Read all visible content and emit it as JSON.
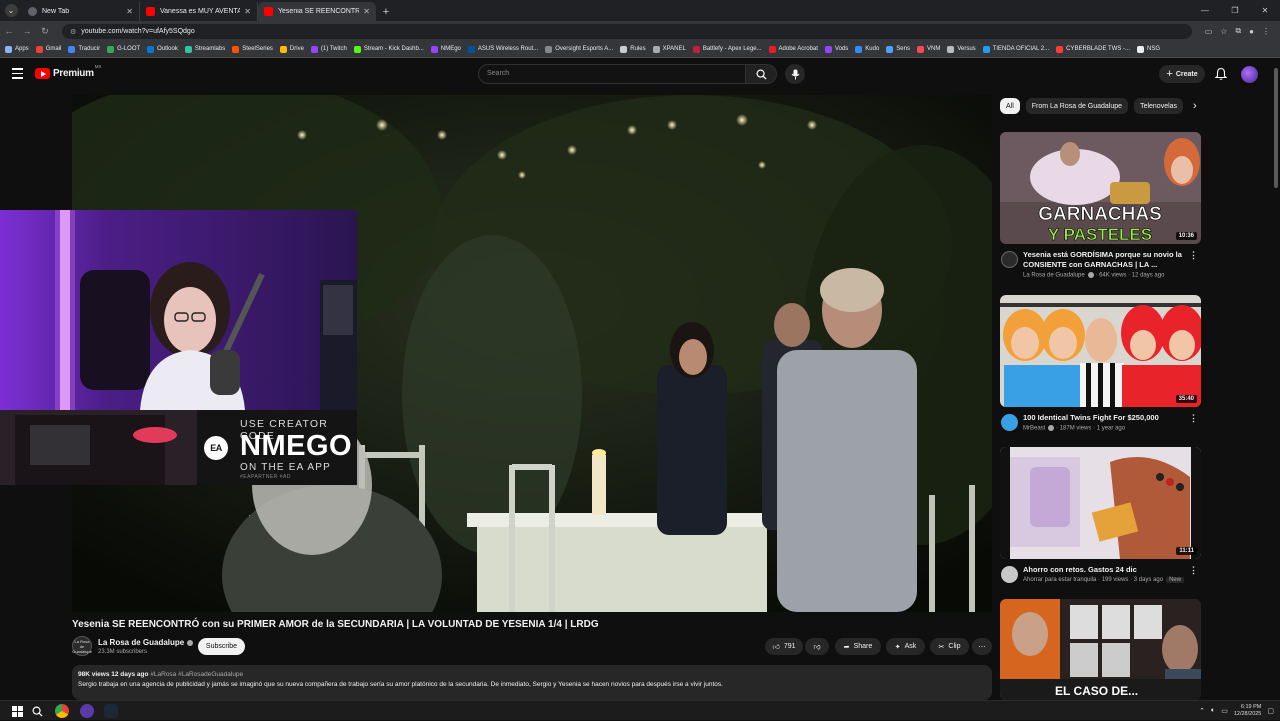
{
  "browser": {
    "tabs": [
      {
        "title": "New Tab",
        "fav_color": "#5f6368",
        "active": false
      },
      {
        "title": "Vanessa es MUY AVENTADA y j",
        "fav_color": "#ff0000",
        "active": false
      },
      {
        "title": "Yesenia SE REENCONTRÓ con s",
        "fav_color": "#ff0000",
        "active": true
      }
    ],
    "new_tab_symbol": "+",
    "url": "youtube.com/watch?v=ufAfy5SQdgo",
    "bookmarks": [
      {
        "label": "Apps",
        "color": "#8ab4f8"
      },
      {
        "label": "Gmail",
        "color": "#ea4335"
      },
      {
        "label": "Traducir",
        "color": "#4285f4"
      },
      {
        "label": "G-LOOT",
        "color": "#34a853"
      },
      {
        "label": "Outlook",
        "color": "#0078d4"
      },
      {
        "label": "Streamlabs",
        "color": "#31c3a2"
      },
      {
        "label": "SteelSeries",
        "color": "#ff5200"
      },
      {
        "label": "Drive",
        "color": "#fbbc04"
      },
      {
        "label": "(1) Twitch",
        "color": "#9146ff"
      },
      {
        "label": "Stream - Kick Dashb...",
        "color": "#53fc18"
      },
      {
        "label": "NMEgo",
        "color": "#9146ff"
      },
      {
        "label": "ASUS Wireless Rout...",
        "color": "#00539b"
      },
      {
        "label": "Oversight Esports A...",
        "color": "#888888"
      },
      {
        "label": "Rules",
        "color": "#cccccc"
      },
      {
        "label": "XPANEL",
        "color": "#aaaaaa"
      },
      {
        "label": "Battlefy - Apex Lege...",
        "color": "#c21f3a"
      },
      {
        "label": "Adobe Acrobat",
        "color": "#ec1c24"
      },
      {
        "label": "Vods",
        "color": "#9146ff"
      },
      {
        "label": "Kudo",
        "color": "#2d8cff"
      },
      {
        "label": "Sens",
        "color": "#4aa3ff"
      },
      {
        "label": "VNM",
        "color": "#ff4655"
      },
      {
        "label": "Versus",
        "color": "#bbbbbb"
      },
      {
        "label": "TIENDA OFICIAL 2...",
        "color": "#1da1f2"
      },
      {
        "label": "CYBERBLADE TWS -...",
        "color": "#ff3b30"
      },
      {
        "label": "NSG",
        "color": "#eeeeee"
      }
    ]
  },
  "youtube": {
    "logo_text": "Premium",
    "region": "MX",
    "search_placeholder": "Search",
    "create_label": "Create",
    "video": {
      "title": "Yesenia SE REENCONTRÓ con su PRIMER AMOR de la SECUNDARIA | LA VOLUNTAD DE YESENIA 1/4 | LRDG",
      "channel": "La Rosa de Guadalupe",
      "channel_avatar_text": "La Rosa de Guadalupe",
      "subscribers": "23.3M subscribers",
      "subscribe_label": "Subscribe",
      "likes": "791",
      "share_label": "Share",
      "ask_label": "Ask",
      "clip_label": "Clip",
      "views_date": "98K views  12 days ago",
      "tags": "#LaRosa #LaRosadeGuadalupe",
      "description": "Sergio trabaja en una agencia de publicidad y jamás se imaginó que su nueva compañera de trabajo sería su amor platónico de la secundaria. De inmediato, Sergio y Yesenia se hacen novios para después irse a vivir juntos."
    },
    "overlay": {
      "line1": "USE CREATOR CODE",
      "line2": "NMEGO",
      "line3": "ON THE EA APP",
      "line4": "#EAPARTNER #AD",
      "ea_logo": "EA"
    },
    "chips": [
      "All",
      "From La Rosa de Guadalupe",
      "Telenovelas"
    ],
    "recommendations": [
      {
        "title": "Yesenia está GORDÍSIMA porque su novio la CONSIENTE con GARNACHAS | LA ...",
        "channel": "La Rosa de Guadalupe",
        "meta": "64K views · 12 days ago",
        "duration": "10:36",
        "thumb_line1": "GARNACHAS",
        "thumb_line2": "Y PASTELES",
        "badge": ""
      },
      {
        "title": "100 Identical Twins Fight For $250,000",
        "channel": "MrBeast",
        "meta": "187M views · 1 year ago",
        "duration": "35:40",
        "badge": ""
      },
      {
        "title": "Ahorro con retos. Gastos 24 dic",
        "channel": "Ahorrar para estar tranquila",
        "meta": "199 views · 3 days ago",
        "duration": "11:11",
        "badge": "New"
      },
      {
        "title": "",
        "channel": "",
        "meta": "",
        "duration": "",
        "thumb_line1": "EL CASO DE...",
        "badge": ""
      }
    ]
  },
  "taskbar": {
    "time": "6:19 PM",
    "date": "12/28/2025"
  }
}
